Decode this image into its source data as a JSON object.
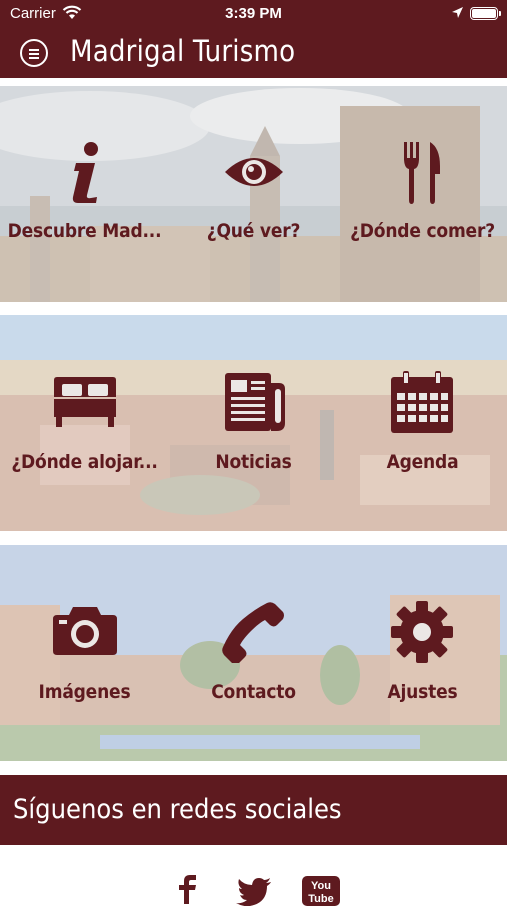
{
  "status": {
    "carrier": "Carrier",
    "time": "3:39 PM"
  },
  "header": {
    "title": "Madrigal Turismo"
  },
  "tiles": [
    {
      "label": "Descubre Mad...",
      "icon": "info-icon"
    },
    {
      "label": "¿Qué ver?",
      "icon": "eye-icon"
    },
    {
      "label": "¿Dónde comer?",
      "icon": "fork-knife-icon"
    },
    {
      "label": "¿Dónde alojar...",
      "icon": "bed-icon"
    },
    {
      "label": "Noticias",
      "icon": "newspaper-icon"
    },
    {
      "label": "Agenda",
      "icon": "calendar-icon"
    },
    {
      "label": "Imágenes",
      "icon": "camera-icon"
    },
    {
      "label": "Contacto",
      "icon": "phone-icon"
    },
    {
      "label": "Ajustes",
      "icon": "gear-icon"
    }
  ],
  "social": {
    "title": "Síguenos en redes sociales",
    "icons": [
      "facebook-icon",
      "twitter-icon",
      "youtube-icon"
    ],
    "youtube_text_top": "You",
    "youtube_text_bottom": "Tube"
  },
  "colors": {
    "primary": "#5e1a1f",
    "background": "#ffffff"
  }
}
